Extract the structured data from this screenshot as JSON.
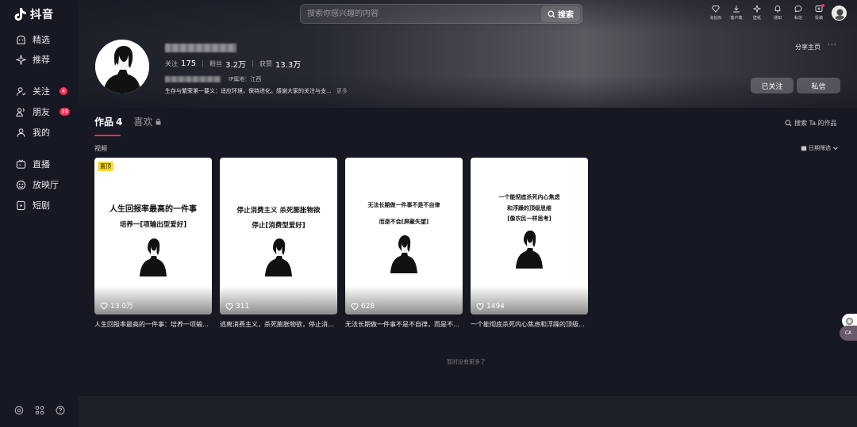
{
  "app": {
    "logo_text": "抖音"
  },
  "sidebar": {
    "items": [
      {
        "label": "精选",
        "icon": "featured-icon"
      },
      {
        "label": "推荐",
        "icon": "recommend-icon"
      },
      {
        "label": "关注",
        "icon": "follow-icon",
        "badge": "4"
      },
      {
        "label": "朋友",
        "icon": "friends-icon",
        "badge": "39"
      },
      {
        "label": "我的",
        "icon": "me-icon"
      },
      {
        "label": "直播",
        "icon": "live-icon"
      },
      {
        "label": "放映厅",
        "icon": "theater-icon"
      },
      {
        "label": "短剧",
        "icon": "drama-icon"
      }
    ],
    "bottom_icons": [
      "settings-icon",
      "apps-icon",
      "help-icon"
    ]
  },
  "header": {
    "search_placeholder": "搜索你感兴趣的内容",
    "search_button": "搜索",
    "icons": [
      {
        "label": "充钻石",
        "icon": "diamond-icon"
      },
      {
        "label": "客户端",
        "icon": "download-icon"
      },
      {
        "label": "壁纸",
        "icon": "wallpaper-icon"
      },
      {
        "label": "通知",
        "icon": "bell-icon"
      },
      {
        "label": "私信",
        "icon": "message-icon"
      },
      {
        "label": "投稿",
        "icon": "upload-icon",
        "dot": true
      }
    ]
  },
  "profile": {
    "stats": [
      {
        "label": "关注",
        "value": "175"
      },
      {
        "label": "粉丝",
        "value": "3.2万"
      },
      {
        "label": "获赞",
        "value": "13.3万"
      }
    ],
    "ip_location": "IP属地：江西",
    "bio": "生存与繁荣第一要义：适应环境，保持进化。感谢大家的关注与支...",
    "bio_more": "更多",
    "share_home": "分享主页",
    "more": "···",
    "followed_button": "已关注",
    "message_button": "私信"
  },
  "tabs": {
    "works_label": "作品",
    "works_count": "4",
    "likes_label": "喜欢",
    "search_label": "搜索 Ta 的作品"
  },
  "section": {
    "label": "视频",
    "date_filter": "日期筛选"
  },
  "videos": [
    {
      "pinned": "置顶",
      "lines": [
        "人生回报率最高的一件事",
        "培养一[项输出型爱好]"
      ],
      "likes": "13.0万",
      "caption": "人生回报率最高的一件事：培养一项输出型爱好"
    },
    {
      "lines": [
        "停止消费主义 杀死膨胀物欲",
        "停止[消费型爱好]"
      ],
      "likes": "311",
      "caption": "逃离消费主义，杀死膨胀物欲，停止消费型爱好"
    },
    {
      "lines": [
        "无法长期做一件事不是不自律",
        "而是不会[屏蔽失望]"
      ],
      "likes": "628",
      "caption": "无法长期做一件事不是不自律，而是不会屏蔽失望"
    },
    {
      "lines": [
        "一个能彻底杀死内心焦虑",
        "和浮躁的顶级思维",
        "[像农民一样思考]"
      ],
      "likes": "1494",
      "caption": "一个能彻底杀死内心焦虑和浮躁的顶级思维"
    }
  ],
  "footer": {
    "no_more": "暂时没有更多了"
  },
  "float": {
    "label": "CA"
  }
}
